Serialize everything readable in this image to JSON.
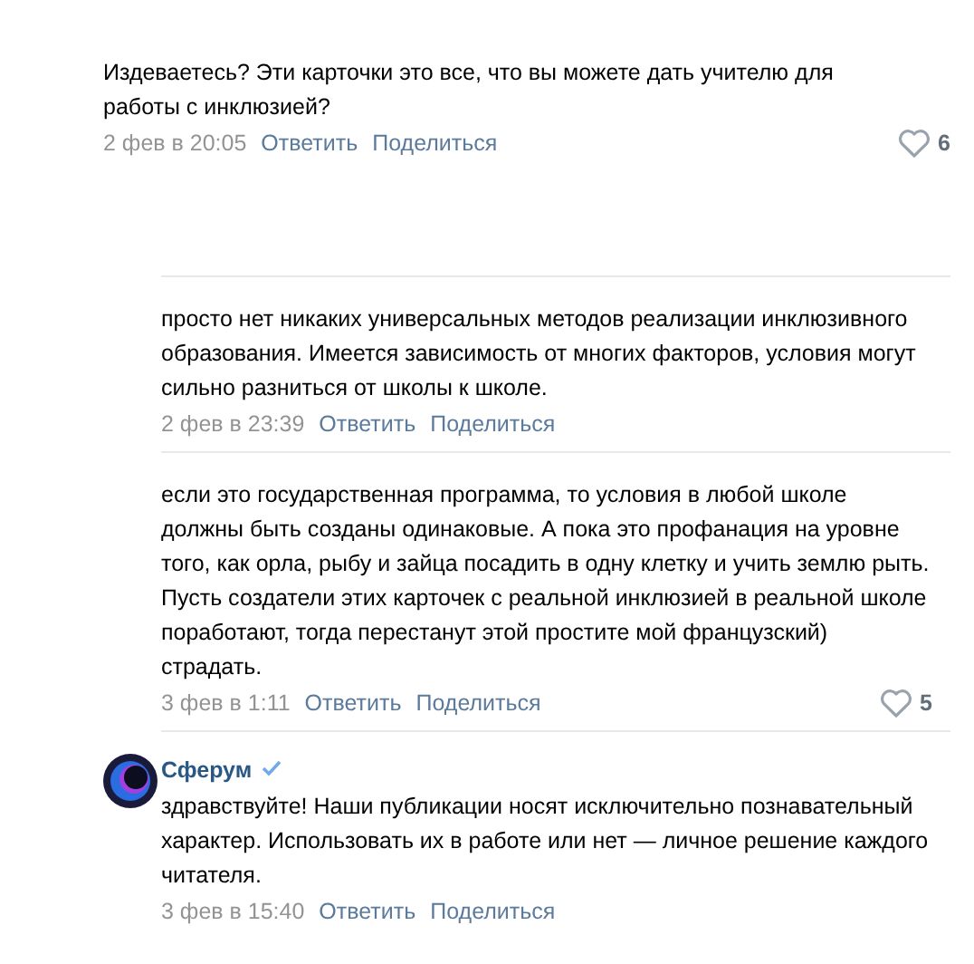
{
  "comments": [
    {
      "kind": "top",
      "text": "Издеваетесь? Эти карточки это все, что вы можете дать учителю для работы с инклюзией?",
      "date": "2 фев в 20:05",
      "actions": [
        "Ответить",
        "Поделиться"
      ],
      "likes": "6"
    },
    {
      "kind": "reply",
      "text": "просто нет никаких универсальных методов реализации инклюзивного образования. Имеется зависимость от многих факторов, условия могут сильно разниться от школы к школе.",
      "date": "2 фев в 23:39",
      "actions": [
        "Ответить",
        "Поделиться"
      ]
    },
    {
      "kind": "reply",
      "text": "если это государственная программа, то условия в любой школе должны быть созданы одинаковые. А пока это профанация на уровне того, как орла, рыбу и зайца посадить в одну клетку и учить землю рыть.\nПусть создатели этих карточек с реальной инклюзией в реальной школе поработают, тогда перестанут этой            простите мой французский) страдать.",
      "date": "3 фев в 1:11",
      "actions": [
        "Ответить",
        "Поделиться"
      ],
      "likes": "5"
    },
    {
      "kind": "reply",
      "author": "Сферум",
      "verified": true,
      "text": "здравствуйте! Наши публикации носят исключительно познавательный характер. Использовать их в работе или нет — личное решение каждого читателя.",
      "date": "3 фев в 15:40",
      "actions": [
        "Ответить",
        "Поделиться"
      ]
    }
  ]
}
